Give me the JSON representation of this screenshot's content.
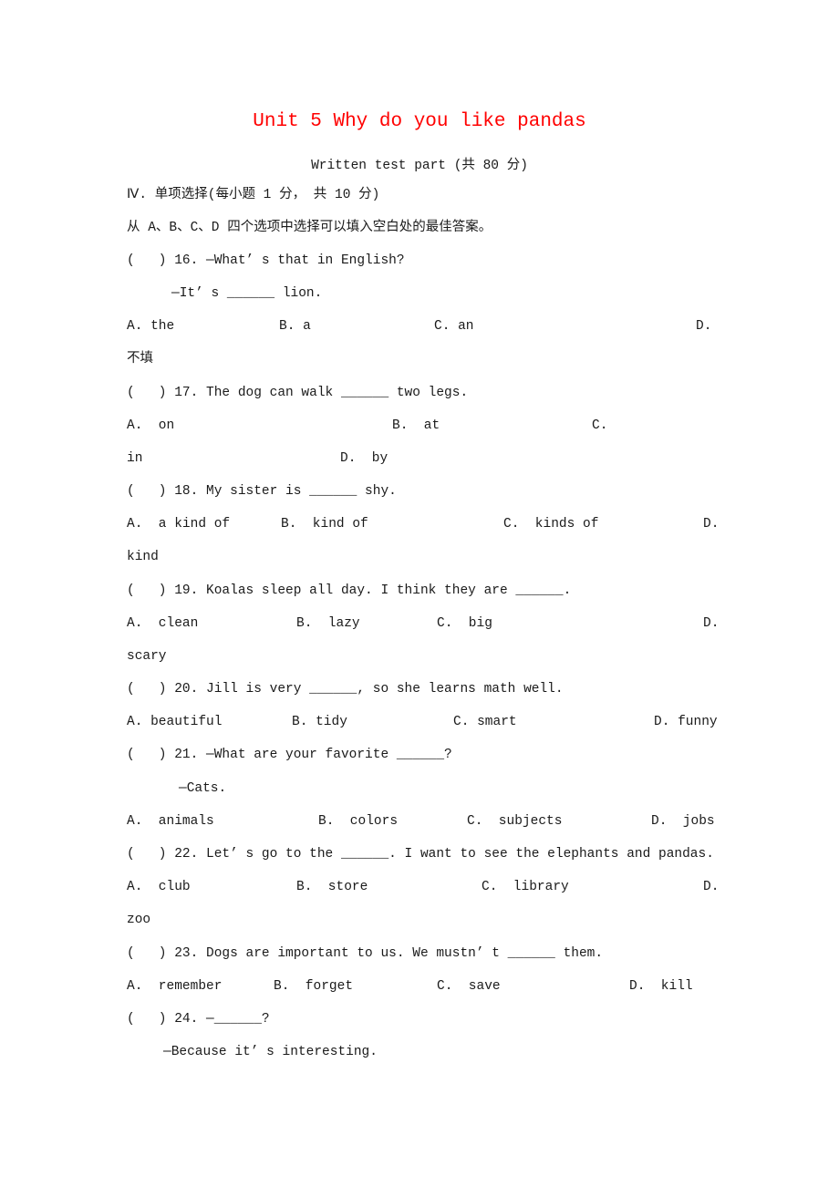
{
  "header": {
    "title": "Unit 5 Why do you like pandas",
    "subtitle": "Written test part (共 80 分)",
    "title_color": "#ff0000"
  },
  "section": {
    "heading": "Ⅳ. 单项选择(每小题 1 分， 共 10 分)",
    "instruction": "从 A、B、C、D 四个选项中选择可以填入空白处的最佳答案。"
  },
  "questions": [
    {
      "stem": "(   ) 16. —What’ s that in English?",
      "stem2": "—It’ s ______ lion.",
      "options": [
        "A. the",
        "B. a",
        "C. an",
        "D."
      ],
      "overflow": "不填"
    },
    {
      "stem": "(   ) 17. The dog can walk ______ two legs.",
      "options": [
        "A.  on",
        "B.  at",
        "C."
      ],
      "overflow": "in",
      "overflow_option": "D.  by"
    },
    {
      "stem": "(   ) 18. My sister is ______ shy.",
      "options": [
        "A.  a kind of",
        "B.  kind of",
        "C.  kinds of",
        "D."
      ],
      "overflow": "kind"
    },
    {
      "stem": "(   ) 19. Koalas sleep all day. I think they are ______.",
      "options": [
        "A.  clean",
        "B.  lazy",
        "C.  big",
        "D."
      ],
      "overflow": "scary"
    },
    {
      "stem": "(   ) 20. Jill is very ______, so she learns math well.",
      "options": [
        "A. beautiful",
        "B. tidy",
        "C. smart",
        "D. funny"
      ]
    },
    {
      "stem": "(   ) 21. —What are your favorite ______?",
      "stem2": "—Cats.",
      "options": [
        "A.  animals",
        "B.  colors",
        "C.  subjects",
        "D.  jobs"
      ]
    },
    {
      "stem": "(   ) 22. Let’ s go to the ______. I want to see the elephants and pandas.",
      "options": [
        "A.  club",
        "B.  store",
        "C.  library",
        "D."
      ],
      "overflow": "zoo"
    },
    {
      "stem": "(   ) 23. Dogs are important to us. We mustn’ t ______ them.",
      "options": [
        "A.  remember",
        "B.  forget",
        "C.  save",
        "D.  kill"
      ]
    },
    {
      "stem": "(   ) 24. —______?",
      "stem2": "—Because it’ s interesting."
    }
  ]
}
